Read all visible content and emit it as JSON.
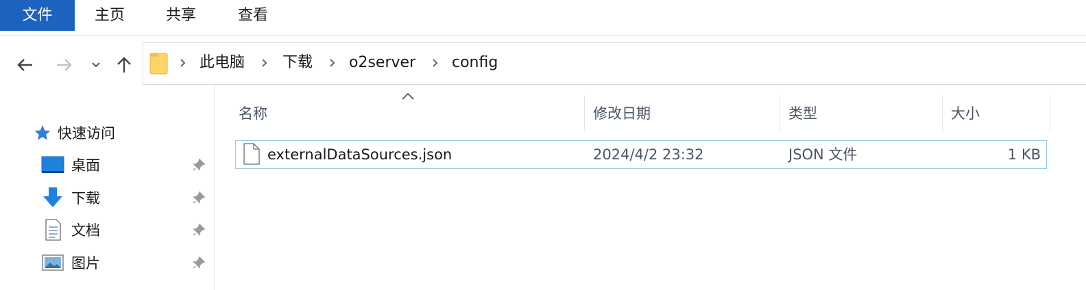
{
  "ribbon": {
    "tabs": [
      "文件",
      "主页",
      "共享",
      "查看"
    ]
  },
  "nav": {
    "back_icon": "arrow-left-icon",
    "forward_icon": "arrow-right-icon",
    "recent_icon": "chevron-down-icon",
    "up_icon": "arrow-up-icon"
  },
  "address": {
    "breadcrumbs": [
      "此电脑",
      "下载",
      "o2server",
      "config"
    ]
  },
  "sidebar": {
    "quick_access": "快速访问",
    "items": [
      {
        "label": "桌面",
        "icon": "desktop-icon"
      },
      {
        "label": "下载",
        "icon": "download-arrow-icon"
      },
      {
        "label": "文档",
        "icon": "document-icon"
      },
      {
        "label": "图片",
        "icon": "pictures-icon"
      }
    ]
  },
  "columns": [
    "名称",
    "修改日期",
    "类型",
    "大小"
  ],
  "files": [
    {
      "name": "externalDataSources.json",
      "modified": "2024/4/2 23:32",
      "type": "JSON 文件",
      "size": "1 KB"
    }
  ],
  "colors": {
    "accent": "#1c63c0",
    "selection_border": "#99c9ef",
    "header_text": "#4a5565"
  }
}
